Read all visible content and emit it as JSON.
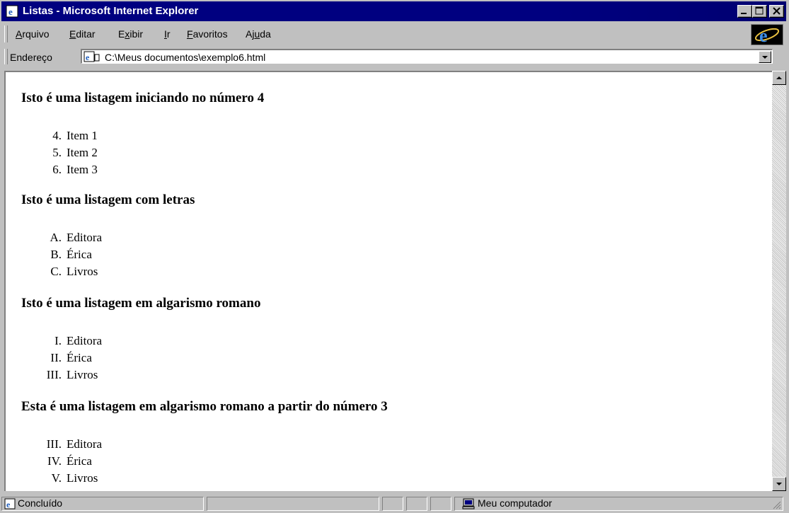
{
  "window": {
    "title": "Listas - Microsoft Internet Explorer"
  },
  "menu": [
    "Arquivo",
    "Editar",
    "Exibir",
    "Ir",
    "Favoritos",
    "Ajuda"
  ],
  "address": {
    "label": "Endereço",
    "url": "C:\\Meus documentos\\exemplo6.html"
  },
  "sections": [
    {
      "heading": "Isto é uma listagem iniciando no número 4",
      "items": [
        {
          "marker": "4.",
          "text": "Item 1"
        },
        {
          "marker": "5.",
          "text": "Item 2"
        },
        {
          "marker": "6.",
          "text": "Item 3"
        }
      ]
    },
    {
      "heading": "Isto é uma listagem com letras",
      "items": [
        {
          "marker": "A.",
          "text": "Editora"
        },
        {
          "marker": "B.",
          "text": "Érica"
        },
        {
          "marker": "C.",
          "text": "Livros"
        }
      ]
    },
    {
      "heading": "Isto é uma listagem em algarismo romano",
      "items": [
        {
          "marker": "I.",
          "text": "Editora"
        },
        {
          "marker": "II.",
          "text": "Érica"
        },
        {
          "marker": "III.",
          "text": "Livros"
        }
      ]
    },
    {
      "heading": "Esta é uma listagem em algarismo romano a partir do número 3",
      "items": [
        {
          "marker": "III.",
          "text": "Editora"
        },
        {
          "marker": "IV.",
          "text": "Érica"
        },
        {
          "marker": "V.",
          "text": "Livros"
        }
      ]
    }
  ],
  "status": {
    "left": "Concluído",
    "zone": "Meu computador"
  }
}
